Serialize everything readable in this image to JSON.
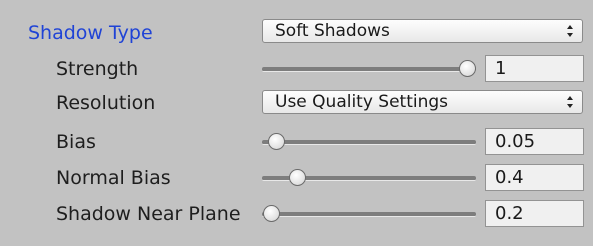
{
  "shadow_type": {
    "label": "Shadow Type",
    "value": "Soft Shadows"
  },
  "strength": {
    "label": "Strength",
    "value": "1",
    "slider_fraction": 1.0
  },
  "resolution": {
    "label": "Resolution",
    "value": "Use Quality Settings"
  },
  "bias": {
    "label": "Bias",
    "value": "0.05",
    "slider_fraction": 0.025
  },
  "normal_bias": {
    "label": "Normal Bias",
    "value": "0.4",
    "slider_fraction": 0.133
  },
  "shadow_near_plane": {
    "label": "Shadow Near Plane",
    "value": "0.2",
    "slider_fraction": 0.0
  },
  "colors": {
    "header_label": "#1f43d6",
    "panel_background": "#c2c2c2"
  },
  "icons": {
    "dropdown": "up-down-arrow-icon",
    "slider": "slider-thumb"
  }
}
